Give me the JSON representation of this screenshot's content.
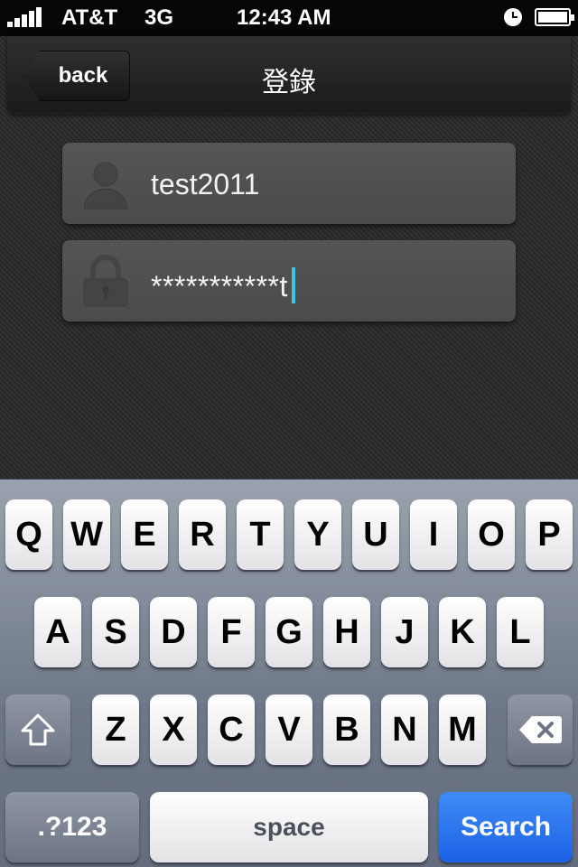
{
  "status_bar": {
    "carrier": "AT&T",
    "network": "3G",
    "time": "12:43 AM"
  },
  "nav": {
    "back_label": "back",
    "title": "登錄"
  },
  "form": {
    "username": "test2011",
    "password_masked": "***********t"
  },
  "keyboard": {
    "row1": [
      "Q",
      "W",
      "E",
      "R",
      "T",
      "Y",
      "U",
      "I",
      "O",
      "P"
    ],
    "row2": [
      "A",
      "S",
      "D",
      "F",
      "G",
      "H",
      "J",
      "K",
      "L"
    ],
    "row3": [
      "Z",
      "X",
      "C",
      "V",
      "B",
      "N",
      "M"
    ],
    "numbers_label": ".?123",
    "space_label": "space",
    "search_label": "Search"
  },
  "colors": {
    "cursor": "#38c8e0",
    "search_key": "#1b62e6"
  }
}
